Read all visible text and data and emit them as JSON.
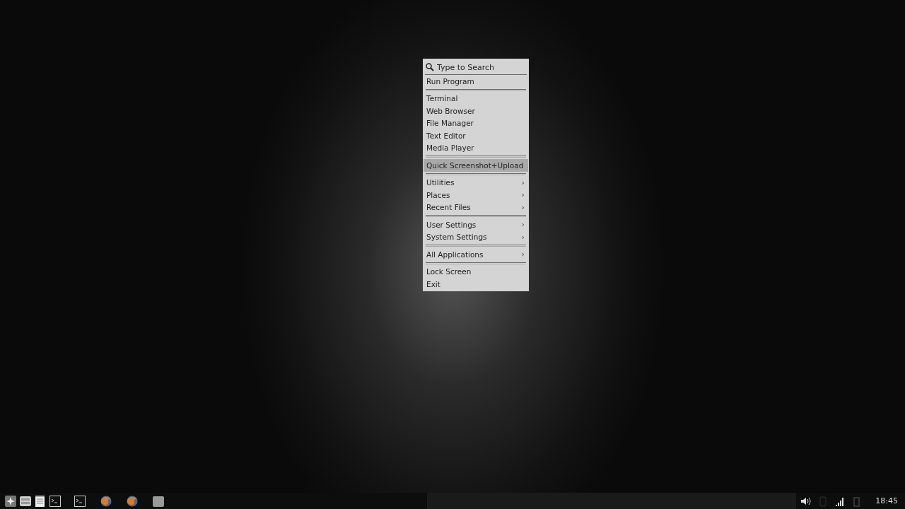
{
  "menu": {
    "search": {
      "placeholder": "Type to Search"
    },
    "sections": [
      [
        {
          "label": "Run Program",
          "submenu": false,
          "selected": false
        }
      ],
      [
        {
          "label": "Terminal",
          "submenu": false,
          "selected": false
        },
        {
          "label": "Web Browser",
          "submenu": false,
          "selected": false
        },
        {
          "label": "File Manager",
          "submenu": false,
          "selected": false
        },
        {
          "label": "Text Editor",
          "submenu": false,
          "selected": false
        },
        {
          "label": "Media Player",
          "submenu": false,
          "selected": false
        }
      ],
      [
        {
          "label": "Quick Screenshot+Upload",
          "submenu": false,
          "selected": true
        }
      ],
      [
        {
          "label": "Utilities",
          "submenu": true,
          "selected": false
        },
        {
          "label": "Places",
          "submenu": true,
          "selected": false
        },
        {
          "label": "Recent Files",
          "submenu": true,
          "selected": false
        }
      ],
      [
        {
          "label": "User Settings",
          "submenu": true,
          "selected": false
        },
        {
          "label": "System Settings",
          "submenu": true,
          "selected": false
        }
      ],
      [
        {
          "label": "All Applications",
          "submenu": true,
          "selected": false
        }
      ],
      [
        {
          "label": "Lock Screen",
          "submenu": false,
          "selected": false
        },
        {
          "label": "Exit",
          "submenu": false,
          "selected": false
        }
      ]
    ],
    "submenu_arrow": "›"
  },
  "taskbar": {
    "launchers": [
      {
        "kind": "menu"
      },
      {
        "kind": "drawer"
      },
      {
        "kind": "notepad"
      },
      {
        "kind": "terminal"
      }
    ],
    "tasks": [
      {
        "kind": "terminal"
      },
      {
        "kind": "browser"
      },
      {
        "kind": "browser"
      },
      {
        "kind": "folder"
      }
    ],
    "clock": "18:45"
  }
}
